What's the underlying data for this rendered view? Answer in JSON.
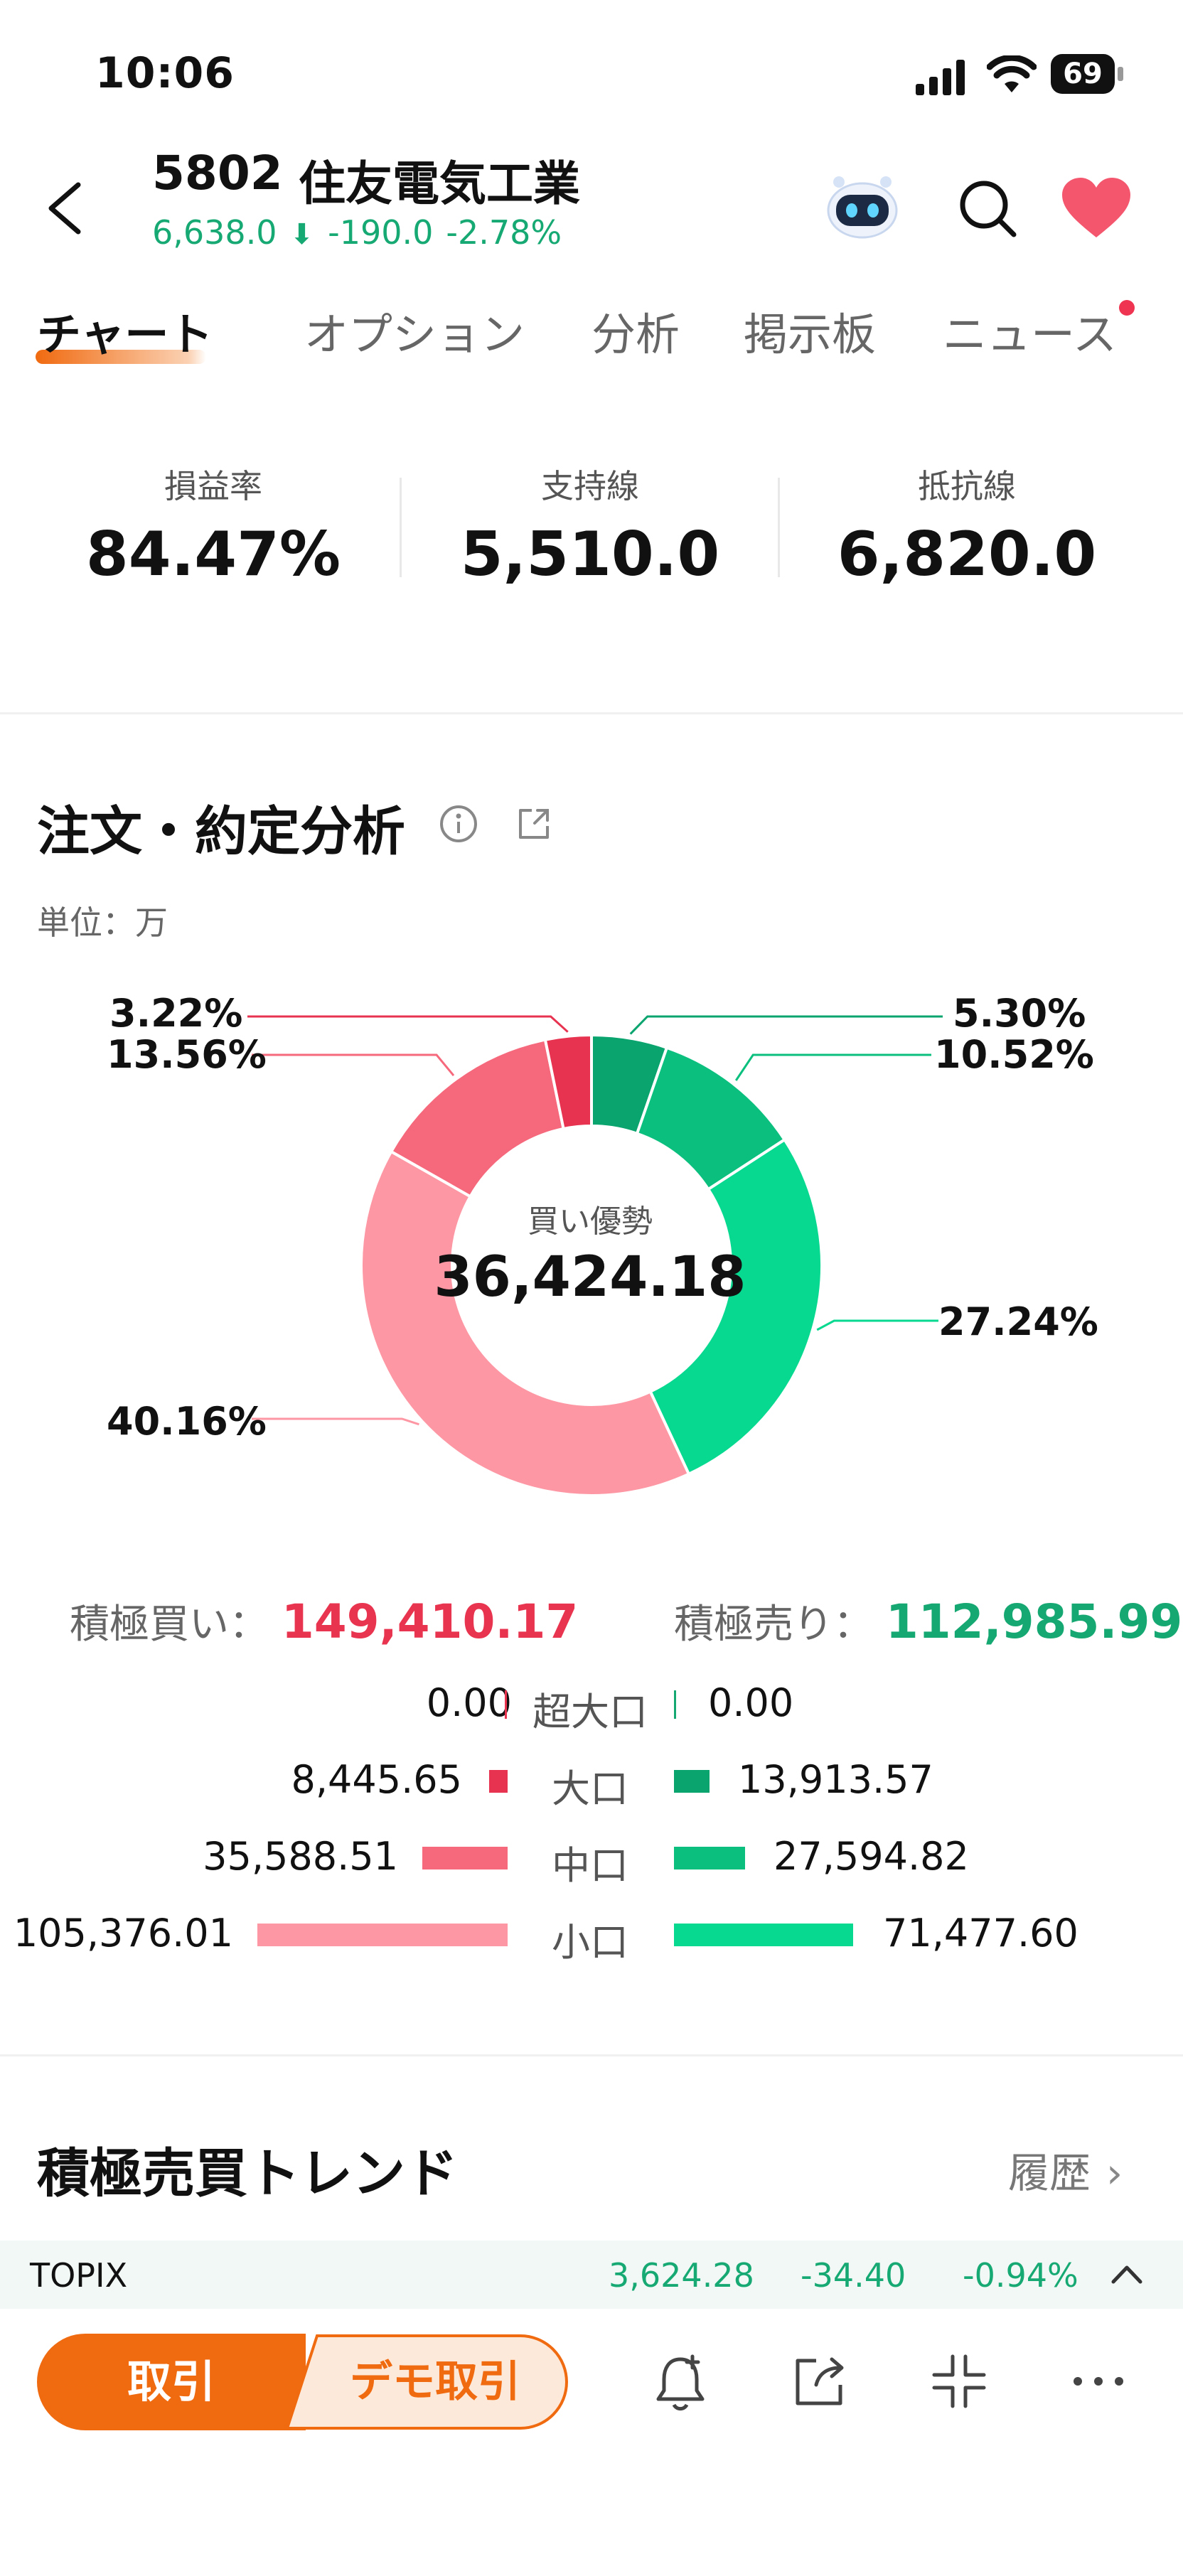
{
  "status_bar": {
    "time": "10:06",
    "battery": "69"
  },
  "header": {
    "code": "5802",
    "name": "住友電気工業",
    "price": "6,638.0",
    "change": "-190.0",
    "change_pct": "-2.78%"
  },
  "tabs": [
    {
      "label": "チャート",
      "active": true
    },
    {
      "label": "オプション",
      "active": false
    },
    {
      "label": "分析",
      "active": false
    },
    {
      "label": "掲示板",
      "active": false
    },
    {
      "label": "ニュース",
      "active": false,
      "badge": true
    }
  ],
  "stats": [
    {
      "label": "損益率",
      "value": "84.47%"
    },
    {
      "label": "支持線",
      "value": "5,510.0"
    },
    {
      "label": "抵抗線",
      "value": "6,820.0"
    }
  ],
  "analysis": {
    "title": "注文・約定分析",
    "unit": "単位：万",
    "center_label": "買い優勢",
    "center_value": "36,424.18",
    "buy_label": "積極買い：",
    "buy_total": "149,410.17",
    "sell_label": "積極売り：",
    "sell_total": "112,985.99",
    "rows": [
      {
        "category": "超大口",
        "buy": "0.00",
        "sell": "0.00"
      },
      {
        "category": "大口",
        "buy": "8,445.65",
        "sell": "13,913.57"
      },
      {
        "category": "中口",
        "buy": "35,588.51",
        "sell": "27,594.82"
      },
      {
        "category": "小口",
        "buy": "105,376.01",
        "sell": "71,477.60"
      }
    ]
  },
  "chart_data": {
    "type": "pie",
    "title": "",
    "slices": [
      {
        "label": "5.30%",
        "value": 5.3,
        "color": "#0aa46f",
        "side": "sell"
      },
      {
        "label": "10.52%",
        "value": 10.52,
        "color": "#0bc07f",
        "side": "sell"
      },
      {
        "label": "27.24%",
        "value": 27.24,
        "color": "#08d990",
        "side": "sell"
      },
      {
        "label": "40.16%",
        "value": 40.16,
        "color": "#fd97a4",
        "side": "buy"
      },
      {
        "label": "13.56%",
        "value": 13.56,
        "color": "#f6687c",
        "side": "buy"
      },
      {
        "label": "3.22%",
        "value": 3.22,
        "color": "#e73350",
        "side": "buy"
      }
    ]
  },
  "trend": {
    "title": "積極売買トレンド",
    "history_label": "履歴"
  },
  "ticker": {
    "name": "TOPIX",
    "value": "3,624.28",
    "change": "-34.40",
    "change_pct": "-0.94%"
  },
  "bottom_bar": {
    "trade_label": "取引",
    "demo_label": "デモ取引"
  },
  "colors": {
    "accent": "#f06a10",
    "buy": "#e9344f",
    "sell": "#16a872"
  }
}
